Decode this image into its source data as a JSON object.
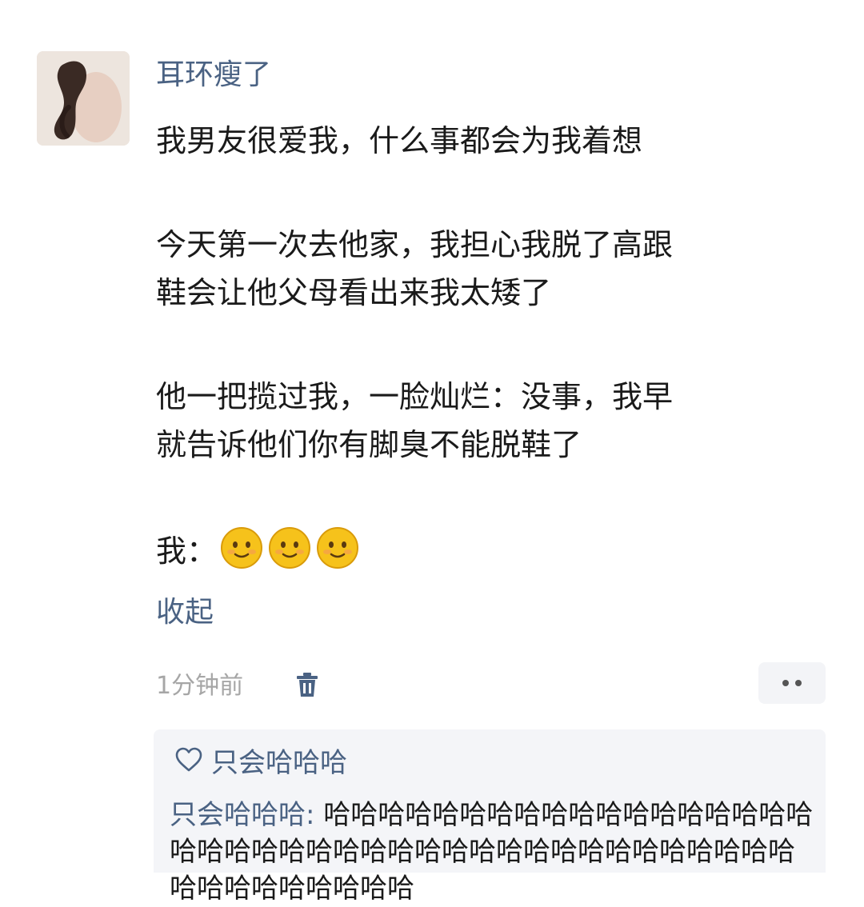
{
  "comment": {
    "username": "耳环瘦了",
    "paragraphs": [
      {
        "lines": [
          "我男友很爱我，什么事都会为我着想"
        ]
      },
      {
        "lines": [
          "今天第一次去他家，我担心我脱了高跟",
          "鞋会让他父母看出来我太矮了"
        ]
      },
      {
        "lines": [
          "他一把揽过我，一脸灿烂：没事，我早",
          "就告诉他们你有脚臭不能脱鞋了"
        ]
      }
    ],
    "me_label": "我：",
    "emojis": [
      "smile-emoji",
      "smile-emoji",
      "smile-emoji"
    ],
    "collapse_label": "收起",
    "time": "1分钟前",
    "icons": {
      "delete": "trash-icon",
      "more": "more-icon"
    }
  },
  "reply_section": {
    "like_icon": "heart-icon",
    "liked_by": "只会哈哈哈",
    "replies": [
      {
        "author": "只会哈哈哈",
        "separator": ": ",
        "text": "哈哈哈哈哈哈哈哈哈哈哈哈哈哈哈哈哈哈哈哈哈哈哈哈哈哈哈哈哈哈哈哈哈哈哈哈哈哈哈哈哈哈哈哈哈哈哈哈哈哈"
      }
    ]
  },
  "colors": {
    "name_blue": "#4a6283",
    "text": "#1a1a1a",
    "muted": "#a6a6a6",
    "reply_bg": "#f4f5f8"
  }
}
